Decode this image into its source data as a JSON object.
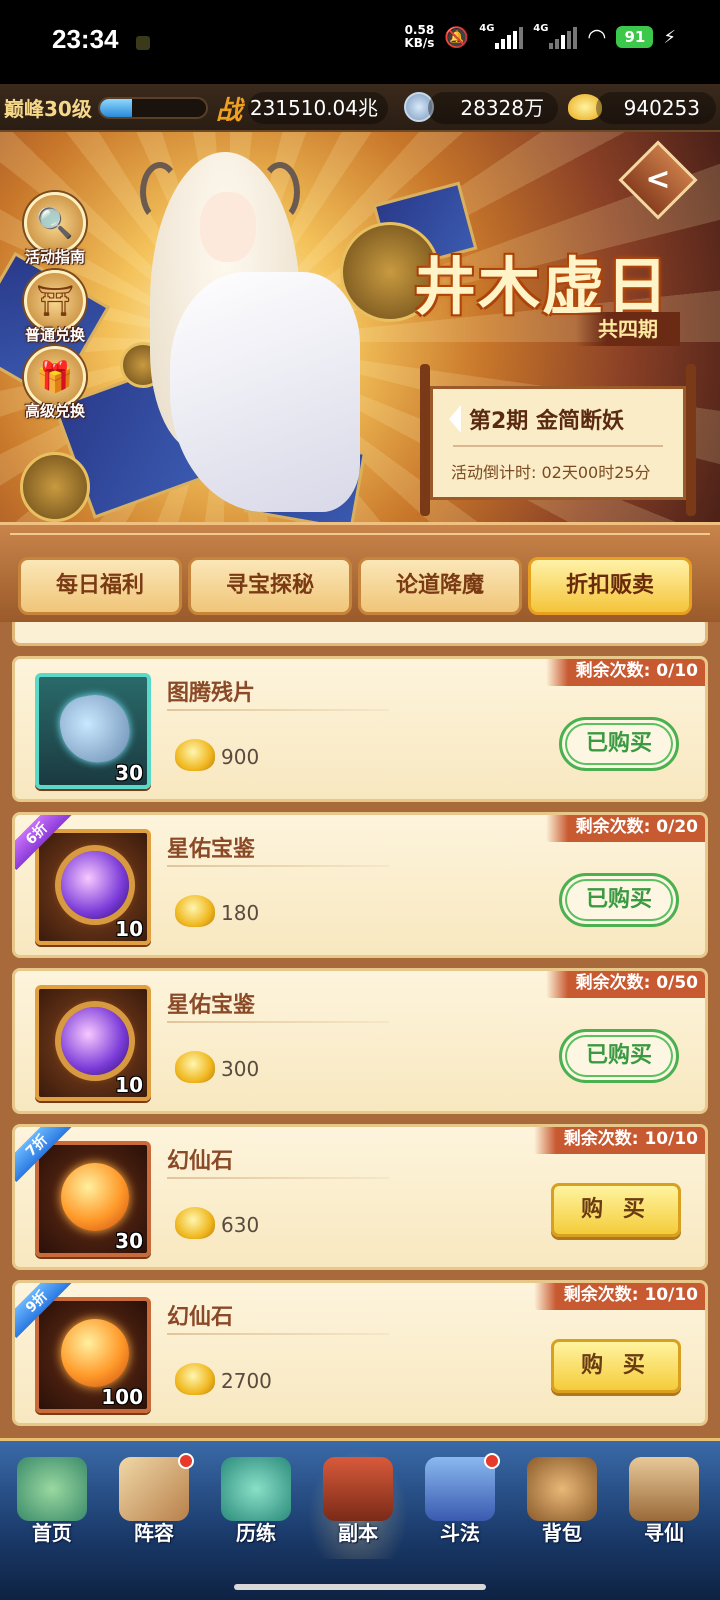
{
  "status_bar": {
    "time": "23:34",
    "speed_value": "0.58",
    "speed_unit": "KB/s",
    "network_1": "4G",
    "network_2": "4G",
    "battery": "91"
  },
  "resources": {
    "level": "巅峰30级",
    "xp_fraction": 0.3,
    "power_icon": "战",
    "power": "231510.04兆",
    "coins": "28328万",
    "gold": "940253"
  },
  "banner": {
    "event_title": "井木虚日",
    "event_subtitle": "共四期",
    "period": "第2期  金简断妖",
    "countdown": "活动倒计时: 02天00时25分",
    "back_label": "<",
    "side_buttons": [
      {
        "label": "活动指南",
        "icon": "magnifier-icon"
      },
      {
        "label": "普通兑换",
        "icon": "shop-icon"
      },
      {
        "label": "高级兑换",
        "icon": "gift-icon"
      }
    ]
  },
  "tabs": [
    {
      "label": "每日福利",
      "active": false
    },
    {
      "label": "寻宝探秘",
      "active": false
    },
    {
      "label": "论道降魔",
      "active": false
    },
    {
      "label": "折扣贩卖",
      "active": true
    }
  ],
  "items": [
    {
      "name": "图腾残片",
      "price": "900",
      "remaining": "剩余次数: 0/10",
      "count": "30",
      "badge": "",
      "button": "已购买",
      "bought": true
    },
    {
      "name": "星佑宝鉴",
      "price": "180",
      "remaining": "剩余次数: 0/20",
      "count": "10",
      "badge": "6折",
      "button": "已购买",
      "bought": true
    },
    {
      "name": "星佑宝鉴",
      "price": "300",
      "remaining": "剩余次数: 0/50",
      "count": "10",
      "badge": "",
      "button": "已购买",
      "bought": true
    },
    {
      "name": "幻仙石",
      "price": "630",
      "remaining": "剩余次数: 10/10",
      "count": "30",
      "badge": "7折",
      "button": "购 买",
      "bought": false
    },
    {
      "name": "幻仙石",
      "price": "2700",
      "remaining": "剩余次数: 10/10",
      "count": "100",
      "badge": "9折",
      "button": "购 买",
      "bought": false
    }
  ],
  "bottom_nav": [
    {
      "label": "首页",
      "dot": false
    },
    {
      "label": "阵容",
      "dot": true
    },
    {
      "label": "历练",
      "dot": false
    },
    {
      "label": "副本",
      "dot": false
    },
    {
      "label": "斗法",
      "dot": true
    },
    {
      "label": "背包",
      "dot": false
    },
    {
      "label": "寻仙",
      "dot": false
    }
  ],
  "colors": {
    "accent_gold": "#f4c43a",
    "bought_green": "#3a9a42",
    "remaining_tag": "#c85a32",
    "card_bg": "#fdf4dc"
  }
}
